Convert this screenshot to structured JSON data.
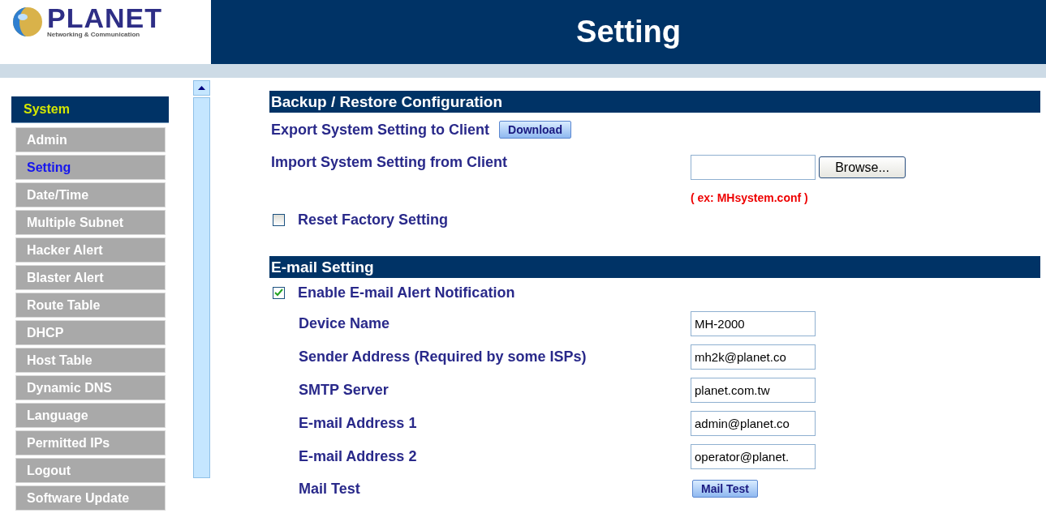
{
  "logo": {
    "name": "PLANET",
    "tagline": "Networking & Communication"
  },
  "header": {
    "title": "Setting"
  },
  "sidebar": {
    "group": "System",
    "items": [
      {
        "label": "Admin",
        "selected": false
      },
      {
        "label": "Setting",
        "selected": true
      },
      {
        "label": "Date/Time",
        "selected": false
      },
      {
        "label": "Multiple Subnet",
        "selected": false
      },
      {
        "label": "Hacker Alert",
        "selected": false
      },
      {
        "label": "Blaster Alert",
        "selected": false
      },
      {
        "label": "Route Table",
        "selected": false
      },
      {
        "label": "DHCP",
        "selected": false
      },
      {
        "label": "Host Table",
        "selected": false
      },
      {
        "label": "Dynamic DNS",
        "selected": false
      },
      {
        "label": "Language",
        "selected": false
      },
      {
        "label": "Permitted IPs",
        "selected": false
      },
      {
        "label": "Logout",
        "selected": false
      },
      {
        "label": "Software Update",
        "selected": false
      }
    ]
  },
  "sections": [
    {
      "title": "Backup / Restore Configuration",
      "rows": [
        {
          "kind": "export",
          "label": "Export System Setting to Client",
          "button": "Download"
        },
        {
          "kind": "file",
          "label": "Import System Setting from Client",
          "button": "Browse...",
          "hint": "( ex: MHsystem.conf )"
        },
        {
          "kind": "check",
          "label": "Reset Factory Setting",
          "checked": false
        }
      ]
    },
    {
      "title": "E-mail Setting",
      "rows": [
        {
          "kind": "check",
          "label": "Enable E-mail Alert Notification",
          "checked": true
        },
        {
          "kind": "field",
          "label": "Device Name",
          "value": "MH-2000"
        },
        {
          "kind": "field",
          "label": "Sender Address (Required by some ISPs)",
          "value": "mh2k@planet.co"
        },
        {
          "kind": "field",
          "label": "SMTP Server",
          "value": "planet.com.tw"
        },
        {
          "kind": "field",
          "label": "E-mail Address 1",
          "value": "admin@planet.co"
        },
        {
          "kind": "field",
          "label": "E-mail Address 2",
          "value": "operator@planet."
        },
        {
          "kind": "action",
          "label": "Mail Test",
          "button": "Mail Test"
        }
      ]
    }
  ]
}
